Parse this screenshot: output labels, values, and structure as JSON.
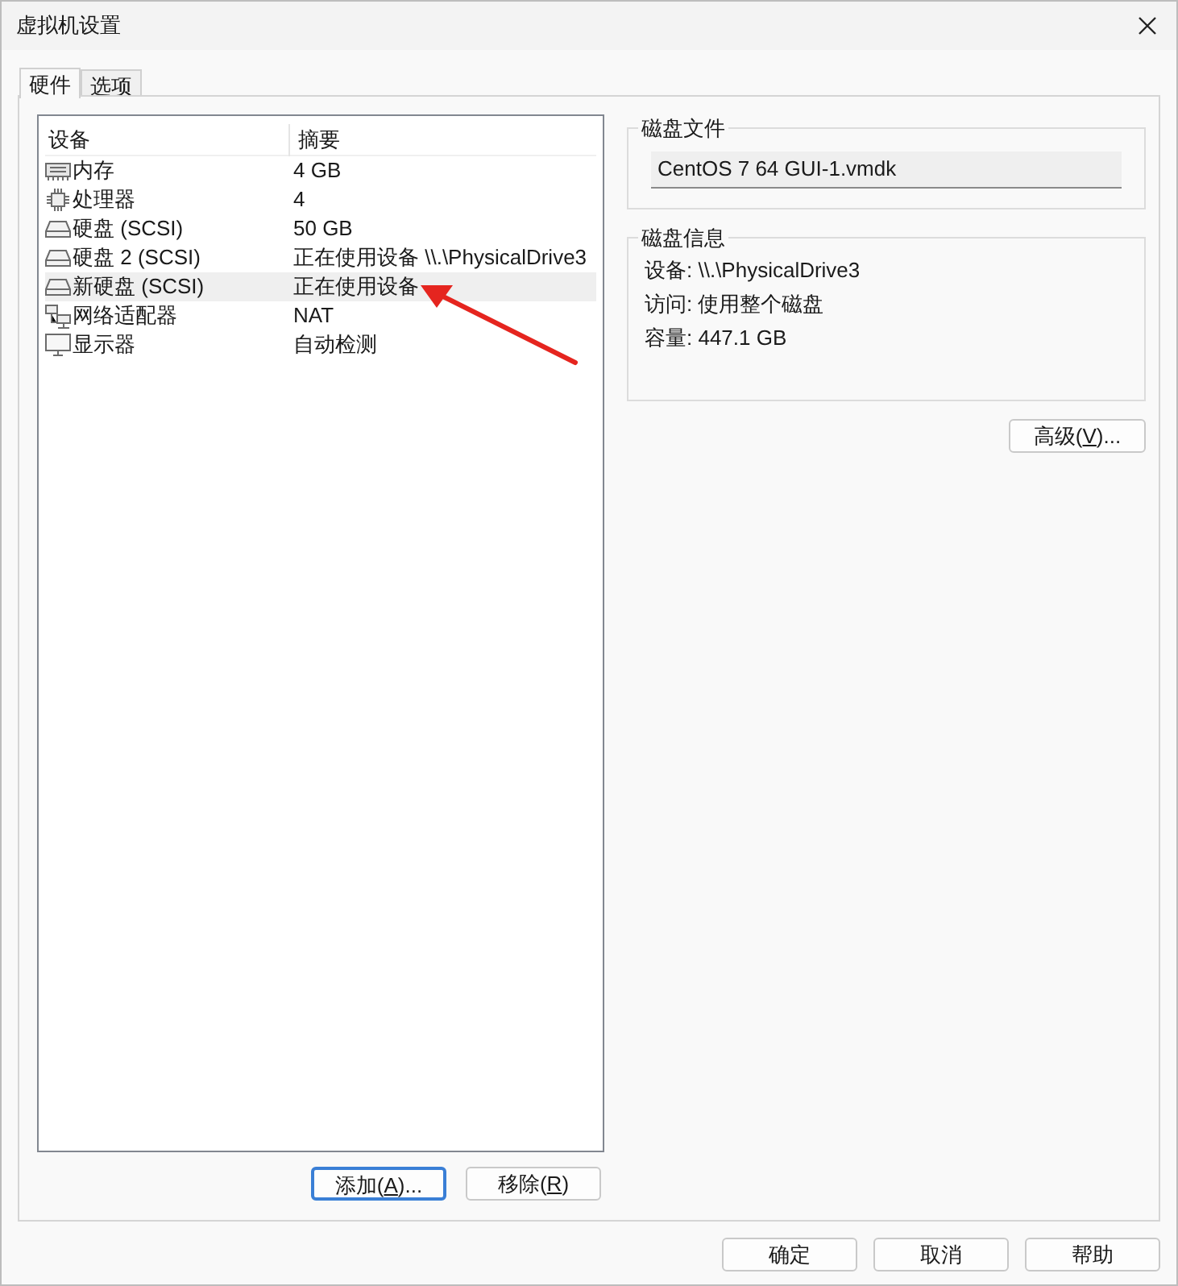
{
  "window": {
    "title": "虚拟机设置"
  },
  "tabs": [
    {
      "label": "硬件",
      "selected": true
    },
    {
      "label": "选项",
      "selected": false
    }
  ],
  "device_list": {
    "columns": [
      "设备",
      "摘要"
    ],
    "rows": [
      {
        "kind": "memory",
        "device": "内存",
        "summary": "4 GB",
        "selected": false
      },
      {
        "kind": "cpu",
        "device": "处理器",
        "summary": "4",
        "selected": false
      },
      {
        "kind": "disk",
        "device": "硬盘 (SCSI)",
        "summary": "50 GB",
        "selected": false
      },
      {
        "kind": "disk",
        "device": "硬盘 2 (SCSI)",
        "summary": "正在使用设备 \\\\.\\PhysicalDrive3",
        "selected": false
      },
      {
        "kind": "disk",
        "device": "新硬盘 (SCSI)",
        "summary": "正在使用设备",
        "selected": true
      },
      {
        "kind": "network",
        "device": "网络适配器",
        "summary": "NAT",
        "selected": false
      },
      {
        "kind": "display",
        "device": "显示器",
        "summary": "自动检测",
        "selected": false
      }
    ]
  },
  "list_buttons": [
    {
      "before": "添加(",
      "key": "A",
      "after": ")...",
      "focused": true
    },
    {
      "before": "移除(",
      "key": "R",
      "after": ")",
      "focused": false
    }
  ],
  "disk_file": {
    "title": "磁盘文件",
    "value": "CentOS 7 64 GUI-1.vmdk"
  },
  "disk_info": {
    "title": "磁盘信息",
    "lines": [
      "设备: \\\\.\\PhysicalDrive3",
      "访问: 使用整个磁盘",
      "容量: 447.1 GB"
    ]
  },
  "advanced_button": {
    "before": "高级(",
    "key": "V",
    "after": ")..."
  },
  "dialog_buttons": [
    "确定",
    "取消",
    "帮助"
  ]
}
